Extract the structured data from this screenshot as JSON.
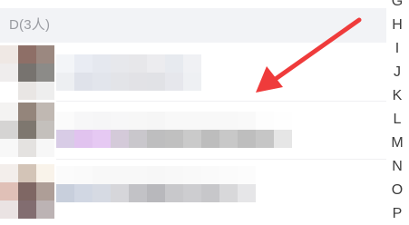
{
  "section": {
    "header_label": "D(3人)"
  },
  "alphabet_index": [
    "G",
    "H",
    "I",
    "J",
    "K",
    "L",
    "M",
    "N",
    "O",
    "P"
  ],
  "contacts": [
    {
      "avatar_colors": [
        [
          "#efe8e4",
          "#8e6f67",
          "#9b8880"
        ],
        [
          "#efeded",
          "#77736f",
          "#8c8b88"
        ],
        [
          "#ffffff",
          "#e9e6e4",
          "#eeeeee"
        ]
      ],
      "name_blocks": [
        [
          "#f3f5f8",
          "#e9ecf3",
          "#e5e8ef",
          "#e7e8ec",
          "#e7e7ea",
          "#ececef",
          "#e7eaef",
          "#f0f1f4"
        ],
        [
          "#edeff2",
          "#dfe2ea",
          "#e2e5ec",
          "#e3e4e8",
          "#e2e2e6",
          "#e1e2e6",
          "#e6e7ec",
          "#eef0f3"
        ]
      ]
    },
    {
      "avatar_colors": [
        [
          "#f4f3f2",
          "#94857b",
          "#c0b8b2"
        ],
        [
          "#d5d4d3",
          "#7e776f",
          "#c4c0bc"
        ],
        [
          "#f8f8f8",
          "#e4e2e0",
          "#f7f7f7"
        ]
      ],
      "name_blocks": [
        [
          "#fbfbfb",
          "#f7f7f8",
          "#f6f6f7",
          "#f7f7f8",
          "#f7f7f7",
          "#f6f6f6",
          "#f8f8f8",
          "#f8f8f8",
          "#f8f8f8",
          "#f8f8f8",
          "#f9f9f9",
          "#fdfdfd",
          "#fefefe"
        ],
        [
          "#d8cce6",
          "#e1c3ef",
          "#e6c9f3",
          "#d4cad9",
          "#c9c7cc",
          "#bebebf",
          "#c0c0c0",
          "#cacaca",
          "#bdbdbd",
          "#c8c8c8",
          "#bebebe",
          "#c6c6c6",
          "#e6e6e6"
        ]
      ]
    },
    {
      "avatar_colors": [
        [
          "#f3eeeb",
          "#d3c4b7",
          "#f9f3ea"
        ],
        [
          "#e0c0b7",
          "#7f6764",
          "#ae9e97"
        ],
        [
          "#eae3e3",
          "#826d70",
          "#bcb3b4"
        ]
      ],
      "name_blocks": [
        [
          "#fbfbfb",
          "#fafafa",
          "#f8f8f8",
          "#f8f8f8",
          "#f8f8f8",
          "#f7f7f7",
          "#f8f8f8",
          "#f9f9f9",
          "#fafafa",
          "#fbfbfb",
          "#fcfcfc"
        ],
        [
          "#c8cfdc",
          "#d1d7e3",
          "#d6dae3",
          "#d6d6da",
          "#c2c2c6",
          "#b8b8bc",
          "#c8c8cb",
          "#cdcdd0",
          "#c7c7ca",
          "#d8d8da",
          "#e6e6e8"
        ]
      ]
    }
  ],
  "annotation": {
    "arrow_color": "#ef3b3b"
  }
}
